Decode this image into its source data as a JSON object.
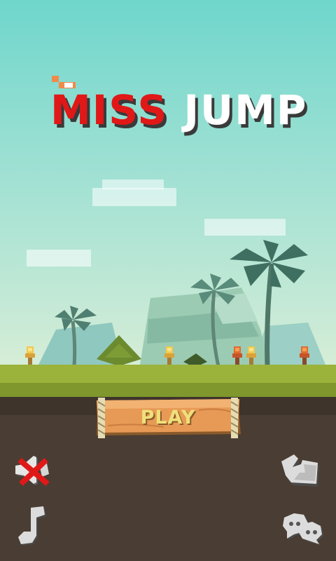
{
  "game": {
    "title_part1": "MISS",
    "title_part2": "JUMP"
  },
  "menu": {
    "play_label": "PLAY"
  },
  "buttons": {
    "sound": {
      "icon": "sound-muted-icon",
      "state": "muted"
    },
    "leaderboard": {
      "icon": "leaderboard-icon"
    },
    "music": {
      "icon": "music-note-icon"
    },
    "chat": {
      "icon": "chat-bubbles-icon"
    }
  },
  "colors": {
    "sky": "#6fd6cc",
    "title_red": "#e01818",
    "grass": "#9bb33a",
    "dirt": "#4a3d34",
    "wood": "#e79a55"
  }
}
